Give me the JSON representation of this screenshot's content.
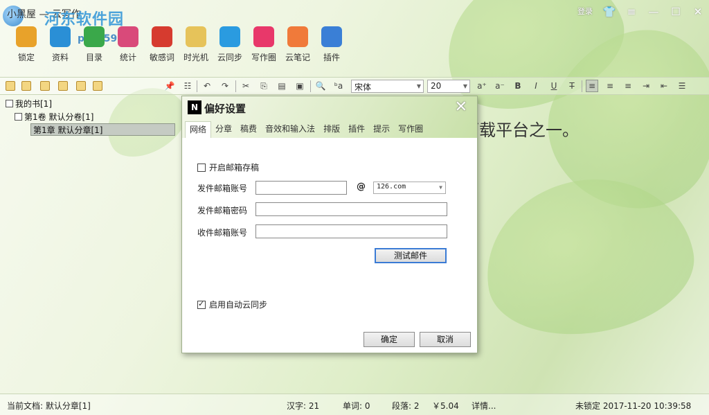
{
  "window": {
    "app_title": "小黑屋 — 云写作",
    "watermark": "河东软件园",
    "watermark_url": "pc0359.cn",
    "login_label": "登录"
  },
  "toolbar": {
    "items": [
      {
        "label": "锁定",
        "icon": "lock-icon",
        "color": "#e8a22a"
      },
      {
        "label": "资料",
        "icon": "book-icon",
        "color": "#2a8fd6"
      },
      {
        "label": "目录",
        "icon": "list-icon",
        "color": "#3aa84a"
      },
      {
        "label": "统计",
        "icon": "chart-icon",
        "color": "#d94a7a"
      },
      {
        "label": "敏感词",
        "icon": "chat-icon",
        "color": "#d63b2f"
      },
      {
        "label": "时光机",
        "icon": "time-icon",
        "color": "#e6c35a"
      },
      {
        "label": "云同步",
        "icon": "cloud-icon",
        "color": "#2a9be0"
      },
      {
        "label": "写作圈",
        "icon": "ring-icon",
        "color": "#e8386a"
      },
      {
        "label": "云笔记",
        "icon": "note-icon",
        "color": "#f07a3a"
      },
      {
        "label": "插件",
        "icon": "plus-icon",
        "color": "#3a7fd6"
      }
    ]
  },
  "format_bar": {
    "font_name": "宋体",
    "font_size": "20"
  },
  "tree": {
    "root": "我的书[1]",
    "volume": "第1卷 默认分卷[1]",
    "chapter": "第1章 默认分章[1]"
  },
  "editor": {
    "text": "下载平台之一。"
  },
  "dialog": {
    "title": "偏好设置",
    "tabs": [
      "网络",
      "分章",
      "稿费",
      "音效和输入法",
      "排版",
      "插件",
      "提示",
      "写作圈"
    ],
    "active_tab": "网络",
    "enable_email_label": "开启邮箱存稿",
    "enable_email_checked": false,
    "send_account_label": "发件邮箱账号",
    "send_account_value": "",
    "at_sign": "@",
    "domain_value": "126.com",
    "send_password_label": "发件邮箱密码",
    "recv_account_label": "收件邮箱账号",
    "test_button": "测试邮件",
    "auto_sync_label": "启用自动云同步",
    "auto_sync_checked": true,
    "ok_button": "确定",
    "cancel_button": "取消"
  },
  "status": {
    "current_doc": "当前文档: 默认分章[1]",
    "chars": "汉字: 21",
    "words": "单词: 0",
    "paragraphs": "段落: 2",
    "price": "￥5.04",
    "details": "详情...",
    "lock_time": "未锁定 2017-11-20 10:39:58"
  }
}
